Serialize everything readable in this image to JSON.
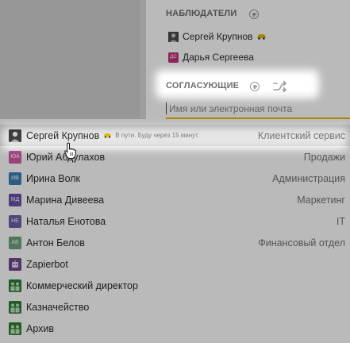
{
  "observers": {
    "title": "НАБЛЮДАТЕЛИ",
    "items": [
      {
        "name": "Сергей Крупнов",
        "avatar_icon": "person-photo-icon",
        "badge_icon": "car-icon"
      },
      {
        "name": "Дарья Сергеева",
        "initials": "ДС",
        "color": "#c2327a"
      }
    ]
  },
  "approvers": {
    "title": "СОГЛАСУЮЩИЕ",
    "add_icon": "plus-circle-icon",
    "swap_icon": "shuffle-icon"
  },
  "email_input": {
    "placeholder": "Имя или электронная почта",
    "value": ""
  },
  "dropdown": {
    "items": [
      {
        "name": "Сергей Крупнов",
        "status": "В пути. Буду через 15 минут.",
        "department": "Клиентский сервис",
        "highlighted": true,
        "avatar_icon": "person-photo-icon",
        "status_icon": "car-icon"
      },
      {
        "name": "Юрий Абдулахов",
        "initials": "ЮА",
        "color": "#d35ba4",
        "department": "Продажи"
      },
      {
        "name": "Ирина Волк",
        "initials": "ИВ",
        "color": "#3d7fb6",
        "department": "Администрация"
      },
      {
        "name": "Марина Дивеева",
        "initials": "МД",
        "color": "#6b4fa8",
        "department": "Маркетинг"
      },
      {
        "name": "Наталья Енотова",
        "initials": "НЕ",
        "color": "#6d5fa6",
        "department": "IT"
      },
      {
        "name": "Антон Белов",
        "initials": "АБ",
        "color": "#6fa27c",
        "department": "Финансовый отдел"
      },
      {
        "name": "Zapierbot",
        "avatar_icon": "robot-icon",
        "color": "#6e4a8c",
        "department": ""
      },
      {
        "name": "Коммерческий директор",
        "avatar_icon": "group-icon",
        "color": "#2f7d32",
        "department": ""
      },
      {
        "name": "Казначейство",
        "avatar_icon": "group-icon",
        "color": "#2f7d32",
        "department": ""
      },
      {
        "name": "Архив",
        "avatar_icon": "group-icon",
        "color": "#2f7d32",
        "department": ""
      }
    ]
  },
  "colors": {
    "accent_underline": "#f0b400",
    "overlay_dim": "rgba(0,0,0,0.27)"
  }
}
